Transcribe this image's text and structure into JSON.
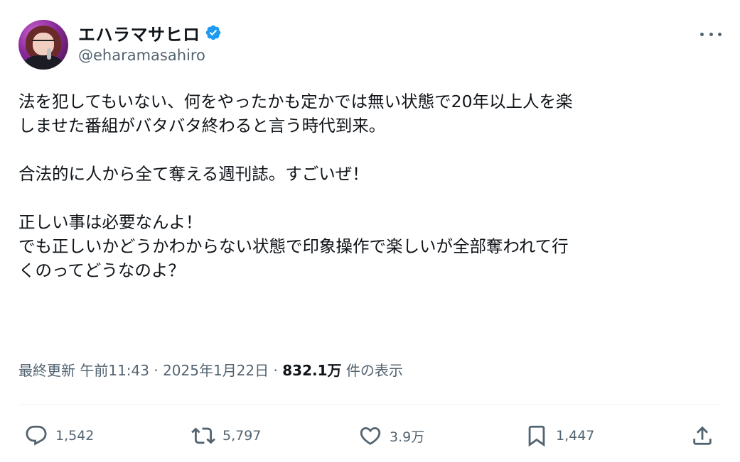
{
  "user": {
    "display_name": "エハラマサヒロ",
    "handle": "@eharamasahiro",
    "verified": true,
    "verified_color": "#1d9bf0"
  },
  "tweet": {
    "lines": [
      "法を犯してもいない、何をやったかも定かでは無い状態で20年以上人を楽",
      "しませた番組がバタバタ終わると言う時代到来。",
      "",
      "合法的に人から全て奪える週刊誌。すごいぜ！",
      "",
      "正しい事は必要なんよ！",
      "でも正しいかどうかわからない状態で印象操作で楽しいが全部奪われて行",
      "くのってどうなのよ？"
    ]
  },
  "meta": {
    "updated_label": "最終更新",
    "time": "午前11:43",
    "separator": "·",
    "date": "2025年1月22日",
    "views_count": "832.1万",
    "views_label": "件の表示"
  },
  "actions": {
    "reply_count": "1,542",
    "retweet_count": "5,797",
    "like_count": "3.9万",
    "bookmark_count": "1,447"
  },
  "icons": {
    "verified": "verified-badge-icon",
    "more": "more-dots-icon",
    "reply": "reply-icon",
    "retweet": "retweet-icon",
    "like": "heart-icon",
    "bookmark": "bookmark-icon",
    "share": "share-icon"
  },
  "colors": {
    "text_primary": "#0f1419",
    "text_secondary": "#536471",
    "accent": "#1d9bf0"
  }
}
